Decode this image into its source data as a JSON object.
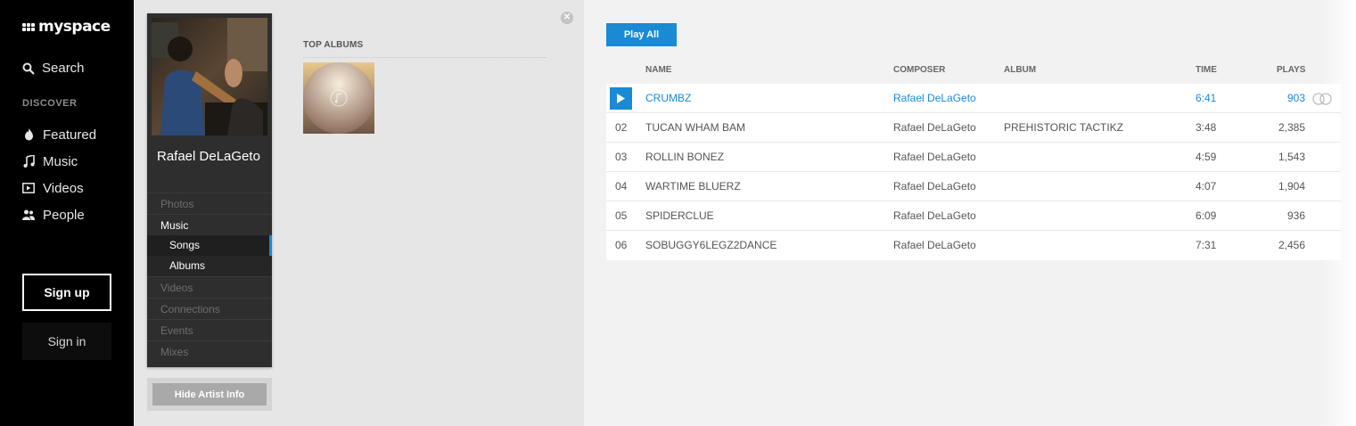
{
  "brand": {
    "name": "myspace"
  },
  "leftnav": {
    "search_label": "Search",
    "discover_label": "DISCOVER",
    "items": [
      {
        "label": "Featured",
        "icon": "flame-icon"
      },
      {
        "label": "Music",
        "icon": "music-note-icon"
      },
      {
        "label": "Videos",
        "icon": "video-icon"
      },
      {
        "label": "People",
        "icon": "people-icon"
      }
    ],
    "signup_label": "Sign up",
    "signin_label": "Sign in"
  },
  "artist": {
    "name": "Rafael DeLaGeto",
    "menu": {
      "photos": "Photos",
      "music": "Music",
      "songs": "Songs",
      "albums": "Albums",
      "videos": "Videos",
      "connections": "Connections",
      "events": "Events",
      "mixes": "Mixes"
    },
    "hide_info_label": "Hide Artist Info",
    "top_albums_label": "TOP ALBUMS"
  },
  "songs": {
    "play_all_label": "Play All",
    "columns": {
      "name": "NAME",
      "composer": "COMPOSER",
      "album": "ALBUM",
      "time": "TIME",
      "plays": "PLAYS"
    },
    "rows": [
      {
        "num": "",
        "name": "CRUMBZ",
        "composer": "Rafael DeLaGeto",
        "album": "",
        "time": "6:41",
        "plays": "903",
        "playing": true
      },
      {
        "num": "02",
        "name": "TUCAN WHAM BAM",
        "composer": "Rafael DeLaGeto",
        "album": "PREHISTORIC TACTIKZ",
        "time": "3:48",
        "plays": "2,385"
      },
      {
        "num": "03",
        "name": "ROLLIN BONEZ",
        "composer": "Rafael DeLaGeto",
        "album": "",
        "time": "4:59",
        "plays": "1,543"
      },
      {
        "num": "04",
        "name": "WARTIME BLUERZ",
        "composer": "Rafael DeLaGeto",
        "album": "",
        "time": "4:07",
        "plays": "1,904"
      },
      {
        "num": "05",
        "name": "SPIDERCLUE",
        "composer": "Rafael DeLaGeto",
        "album": "",
        "time": "6:09",
        "plays": "936"
      },
      {
        "num": "06",
        "name": "SOBUGGY6LEGZ2DANCE",
        "composer": "Rafael DeLaGeto",
        "album": "",
        "time": "7:31",
        "plays": "2,456"
      }
    ]
  },
  "colors": {
    "accent": "#1a8ad4",
    "nav_bg": "#000000",
    "card_bg": "#2e2e2e"
  }
}
